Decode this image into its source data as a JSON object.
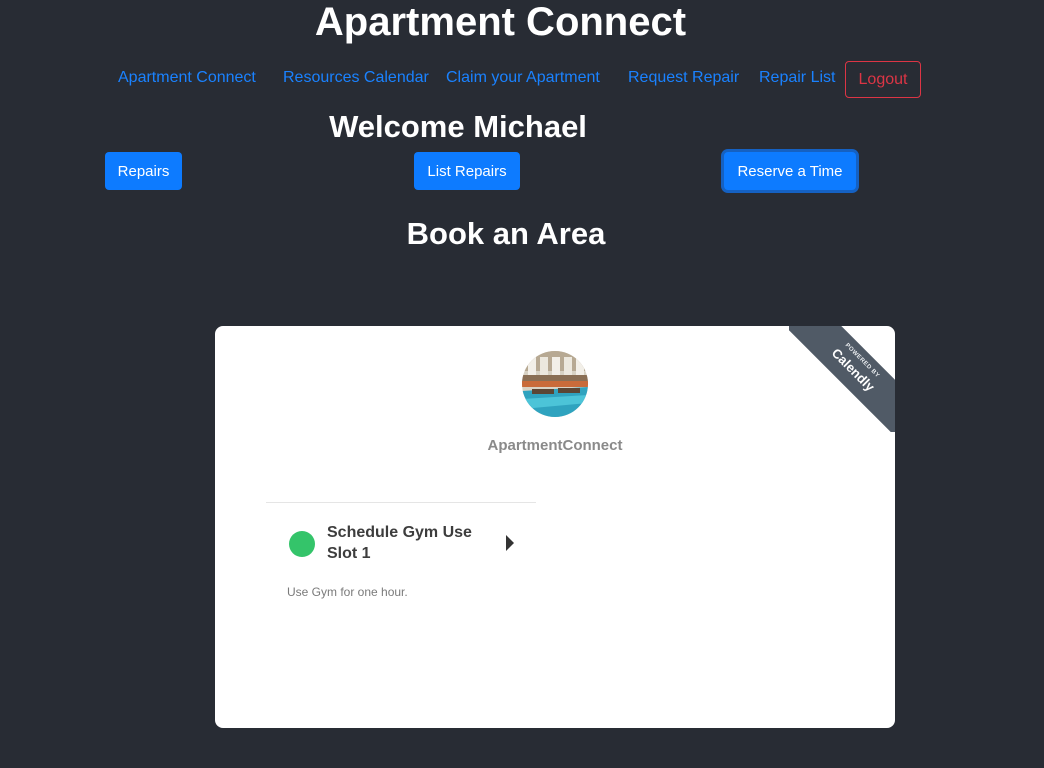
{
  "site": {
    "title": "Apartment Connect"
  },
  "nav": {
    "items": [
      {
        "label": "Apartment Connect"
      },
      {
        "label": "Resources Calendar"
      },
      {
        "label": "Claim your Apartment"
      },
      {
        "label": "Request Repair"
      },
      {
        "label": "Repair List"
      }
    ],
    "logout_label": "Logout"
  },
  "welcome": {
    "text": "Welcome Michael"
  },
  "actions": {
    "repairs_label": "Repairs",
    "list_repairs_label": "List Repairs",
    "reserve_label": "Reserve a Time"
  },
  "booking": {
    "title": "Book an Area"
  },
  "calendly": {
    "org_name": "ApartmentConnect",
    "ribbon_small": "POWERED BY",
    "ribbon_brand": "Calendly",
    "event": {
      "title": "Schedule Gym Use Slot 1",
      "description": "Use Gym for one hour.",
      "color": "#34c46a"
    }
  },
  "colors": {
    "background": "#282c34",
    "link": "#1a82ff",
    "primary": "#0d7bff",
    "danger": "#dc3545"
  }
}
